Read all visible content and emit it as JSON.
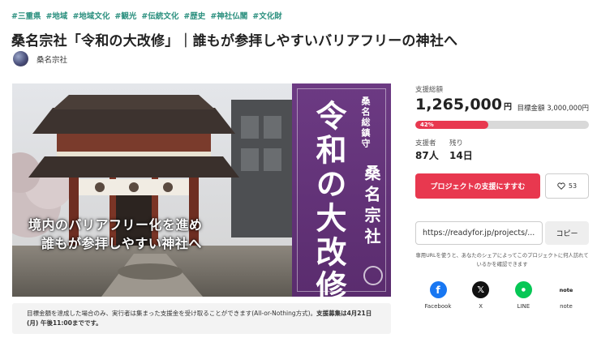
{
  "tags": [
    "#三重県",
    "#地域",
    "#地域文化",
    "#観光",
    "#伝統文化",
    "#歴史",
    "#神社仏閣",
    "#文化財"
  ],
  "title": "桑名宗社「令和の大改修」｜誰もが参拝しやすいバリアフリーの神社へ",
  "owner": {
    "name": "桑名宗社"
  },
  "hero": {
    "caption_line1": "境内のバリアフリー化を進め",
    "caption_line2": "誰もが参拝しやすい神社へ",
    "banner_sub": "桑名総鎮守",
    "banner_main": "令和の大改修",
    "banner_name": "桑名宗社"
  },
  "notice": {
    "text": "目標金額を達成した場合のみ、実行者は集まった支援金を受け取ることができます(All-or-Nothing方式)。",
    "deadline": "支援募集は4月21日(月) 午後11:00までです。"
  },
  "funding": {
    "total_label": "支援総額",
    "amount": "1,265,000",
    "currency": "円",
    "goal_label": "目標金額",
    "goal_value": "3,000,000円",
    "progress_text": "42%",
    "progress_fraction": 0.42,
    "supporters_label": "支援者",
    "supporters_value": "87人",
    "remaining_label": "残り",
    "remaining_value": "14日"
  },
  "actions": {
    "support_label": "プロジェクトの支援にすすむ",
    "favorite_count": "53",
    "url_value": "https://readyfor.jp/projects/...",
    "copy_label": "コピー",
    "share_note": "専用URLを使うと、あなたのシェアによってこのプロジェクトに何人訪れているかを確認できます"
  },
  "shares": [
    {
      "label": "Facebook",
      "icon": "facebook-icon"
    },
    {
      "label": "X",
      "icon": "x-icon"
    },
    {
      "label": "LINE",
      "icon": "line-icon"
    },
    {
      "label": "note",
      "icon": "note-icon"
    }
  ],
  "colors": {
    "accent": "#e8384f",
    "tag": "#2a8f7e",
    "banner": "#6c3a83"
  }
}
